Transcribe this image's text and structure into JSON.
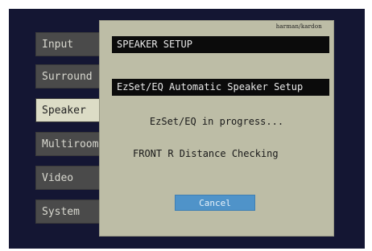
{
  "sidebar": {
    "items": [
      {
        "label": "Input"
      },
      {
        "label": "Surround"
      },
      {
        "label": "Speaker",
        "selected": true
      },
      {
        "label": "Multiroom"
      },
      {
        "label": "Video"
      },
      {
        "label": "System"
      }
    ]
  },
  "panel": {
    "brand": "harman/kardon",
    "title": "SPEAKER SETUP",
    "subtitle": "EzSet/EQ Automatic Speaker Setup",
    "progress": "EzSet/EQ in progress...",
    "status": "FRONT R  Distance Checking",
    "cancel_label": "Cancel"
  },
  "colors": {
    "background": "#141633",
    "panel": "#bdbda6",
    "sidebar_item": "#4a4a4a",
    "sidebar_selected": "#dcdcc6",
    "button_accent": "#4f93c9"
  }
}
